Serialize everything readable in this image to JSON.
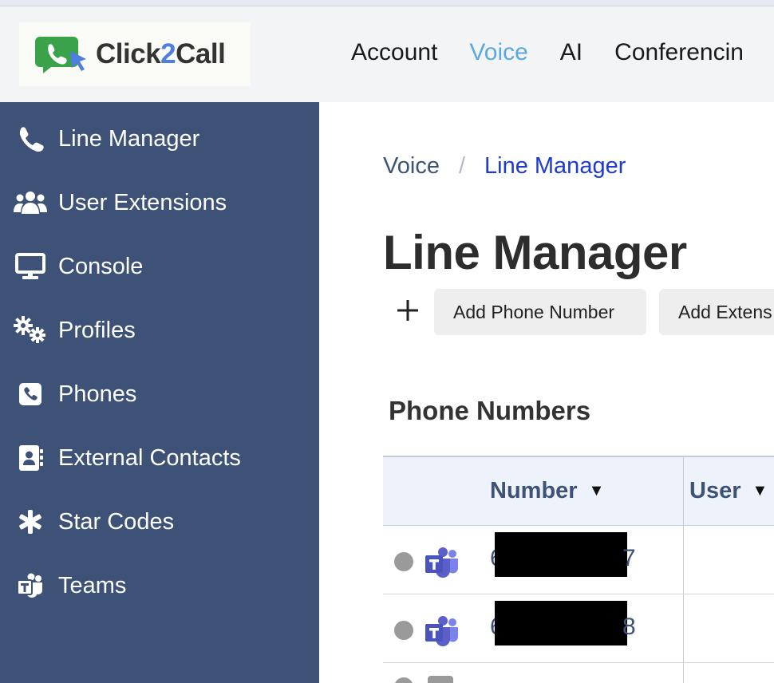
{
  "app": {
    "logo_text_1": "Click",
    "logo_text_2": "2",
    "logo_text_3": "Call"
  },
  "topnav": {
    "items": [
      {
        "label": "Account",
        "active": false
      },
      {
        "label": "Voice",
        "active": true
      },
      {
        "label": "AI",
        "active": false
      },
      {
        "label": "Conferencin",
        "active": false
      }
    ]
  },
  "sidebar": {
    "items": [
      {
        "label": "Line Manager",
        "icon": "phone-icon"
      },
      {
        "label": "User Extensions",
        "icon": "users-icon"
      },
      {
        "label": "Console",
        "icon": "monitor-icon"
      },
      {
        "label": "Profiles",
        "icon": "gears-icon"
      },
      {
        "label": "Phones",
        "icon": "phone-square-icon"
      },
      {
        "label": "External Contacts",
        "icon": "address-book-icon"
      },
      {
        "label": "Star Codes",
        "icon": "asterisk-icon"
      },
      {
        "label": "Teams",
        "icon": "teams-icon"
      }
    ]
  },
  "breadcrumb": {
    "root": "Voice",
    "separator": "/",
    "current": "Line Manager"
  },
  "page": {
    "title": "Line Manager",
    "add_phone_label": "Add Phone Number",
    "add_ext_label": "Add Extens",
    "section_title": "Phone Numbers"
  },
  "table": {
    "columns": [
      {
        "label": "Number",
        "sort_arrow": "▼"
      },
      {
        "label": "User",
        "sort_arrow": "▼"
      }
    ],
    "rows": [
      {
        "number_start": "6",
        "number_end": "7",
        "user": ""
      },
      {
        "number_start": "6",
        "number_end": "8",
        "user": ""
      }
    ]
  },
  "colors": {
    "sidebar_bg": "#3e5278",
    "active_nav": "#5aa9e0",
    "breadcrumb_current": "#1d3bd0",
    "teams_purple": "#5b5fc7",
    "logo_green": "#3aa34a"
  }
}
